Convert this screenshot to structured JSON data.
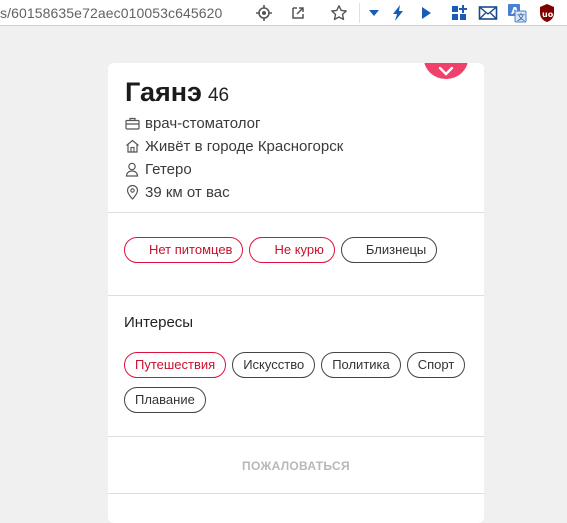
{
  "browser": {
    "url": "s/60158635e72aec010053c645620",
    "icons": [
      "location-target-icon",
      "open-in-new-icon",
      "star-icon",
      "dropdown-arrow-icon",
      "bolt-icon",
      "play-icon",
      "extensions-grid-icon",
      "mail-icon",
      "translate-icon",
      "ublock-icon"
    ],
    "colors": {
      "accent": "#1a5bb8",
      "ublock": "#800000"
    }
  },
  "profile": {
    "name": "Гаянэ",
    "age": "46",
    "profession": "врач-стоматолог",
    "city": "Живёт в городе Красногорск",
    "orientation": "Гетеро",
    "distance": "39 км от вас"
  },
  "traits": [
    {
      "label": "Нет питомцев",
      "style": "red"
    },
    {
      "label": "Не курю",
      "style": "red"
    },
    {
      "label": "Близнецы",
      "style": "dark"
    }
  ],
  "interests": {
    "title": "Интересы",
    "items": [
      {
        "label": "Путешествия",
        "style": "red"
      },
      {
        "label": "Искусство",
        "style": "dark"
      },
      {
        "label": "Политика",
        "style": "dark"
      },
      {
        "label": "Спорт",
        "style": "dark"
      },
      {
        "label": "Плавание",
        "style": "dark"
      }
    ]
  },
  "report_label": "ПОЖАЛОВАТЬСЯ",
  "colors": {
    "brand": "#f0416c",
    "chip_red": "#e0103c",
    "muted": "#b8b8b8"
  }
}
